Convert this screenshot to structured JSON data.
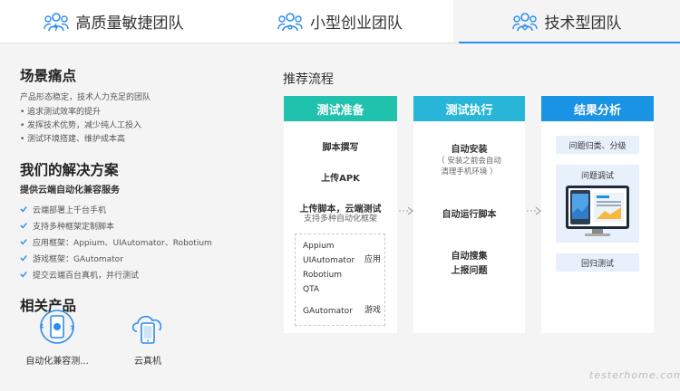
{
  "tabs": [
    {
      "label": "高质量敏捷团队",
      "icon": "team-icon"
    },
    {
      "label": "小型创业团队",
      "icon": "team-icon"
    },
    {
      "label": "技术型团队",
      "icon": "team-icon",
      "active": true
    }
  ],
  "scenario": {
    "title": "场景痛点",
    "subtitle": "产品形态稳定，技术人力充足的团队",
    "points": [
      "追求测试效率的提升",
      "发挥技术优势，减少纯人工投入",
      "测试环境搭建、维护成本高"
    ]
  },
  "solution": {
    "title": "我们的解决方案",
    "subtitle": "提供云端自动化兼容服务",
    "items": [
      "云端部署上千台手机",
      "支持多种框架定制脚本",
      "应用框架：Appium、UIAutomator、Robotium",
      "游戏框架：GAutomator",
      "提交云端百台真机，并行测试"
    ]
  },
  "related": {
    "title": "相关产品",
    "products": [
      {
        "label": "自动化兼容测...",
        "icon": "auto-compat-icon"
      },
      {
        "label": "云真机",
        "icon": "cloud-phone-icon"
      }
    ]
  },
  "flow": {
    "title": "推荐流程",
    "prepare": {
      "head": "测试准备",
      "step1": "脚本撰写",
      "step2": "上传APK",
      "step3": "上传脚本，云端测试",
      "step3_sub": "支持多种自动化框架",
      "frameworks": [
        "Appium",
        "UIAutomator",
        "Robotium",
        "QTA",
        "GAutomator"
      ],
      "app_label": "应用",
      "game_label": "游戏"
    },
    "execute": {
      "head": "测试执行",
      "step1": "自动安装",
      "step1_sub1": "（ 安装之前会自动",
      "step1_sub2": "清理手机环境 ）",
      "step2": "自动运行脚本",
      "step3a": "自动搜集",
      "step3b": "上报问题"
    },
    "analyze": {
      "head": "结果分析",
      "step1": "问题归类、分级",
      "step2": "问题调试",
      "step3": "回归测试"
    }
  },
  "watermark": "testerhome.com",
  "colors": {
    "prepare": "#21c2ad",
    "execute": "#27b6d8",
    "analyze": "#1993e3",
    "accent": "#2d8cf0"
  }
}
